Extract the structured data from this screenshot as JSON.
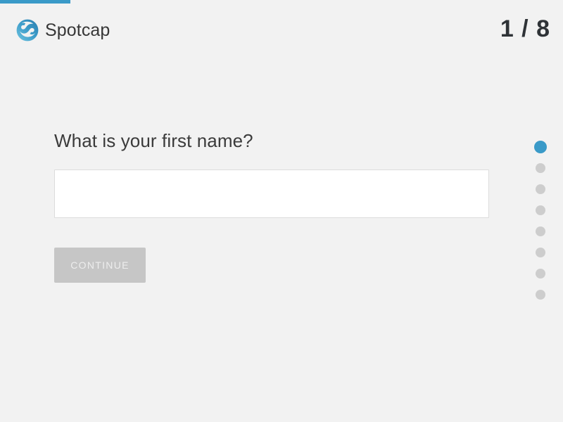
{
  "brand": {
    "name": "Spotcap",
    "logo_icon": "spotcap-s-swirl-icon",
    "logo_color": "#3a9ac8",
    "text_color": "#373737"
  },
  "progress": {
    "current_step": 1,
    "total_steps": 8,
    "counter_label": "1 / 8",
    "percent": 12.5,
    "bar_color": "#3a9ac8"
  },
  "form": {
    "question": "What is your first name?",
    "input": {
      "value": "",
      "placeholder": ""
    },
    "continue_label": "CONTINUE",
    "continue_enabled": false,
    "continue_bg": "#c6c6c6"
  },
  "step_dots": [
    {
      "label": "step-1",
      "state": "active"
    },
    {
      "label": "step-2",
      "state": "inactive"
    },
    {
      "label": "step-3",
      "state": "inactive"
    },
    {
      "label": "step-4",
      "state": "inactive"
    },
    {
      "label": "step-5",
      "state": "inactive"
    },
    {
      "label": "step-6",
      "state": "inactive"
    },
    {
      "label": "step-7",
      "state": "inactive"
    },
    {
      "label": "step-8",
      "state": "inactive"
    }
  ],
  "theme": {
    "background": "#f2f2f2",
    "accent": "#3a9ac8",
    "muted": "#cdcdcd"
  }
}
